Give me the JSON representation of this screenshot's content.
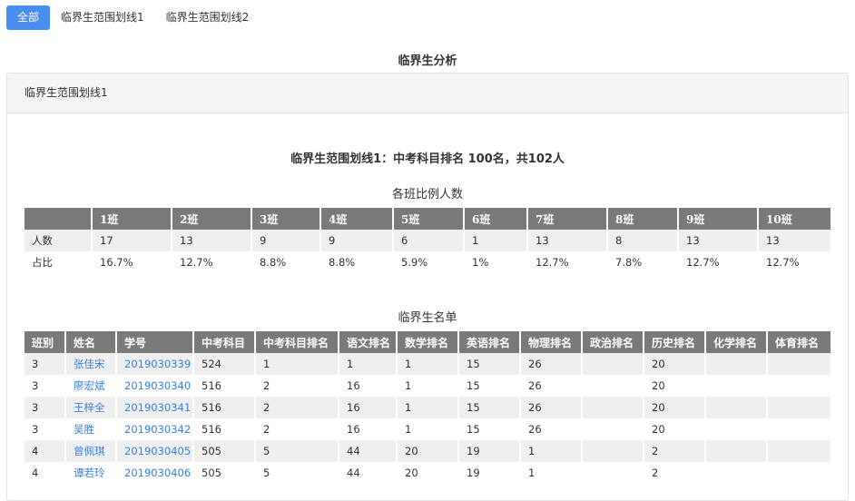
{
  "tabs": [
    "全部",
    "临界生范围划线1",
    "临界生范围划线2"
  ],
  "page_title": "临界生分析",
  "panel": {
    "header": "临界生范围划线1",
    "summary": "临界生范围划线1：中考科目排名 100名，共102人",
    "ratio_caption": "各班比例人数",
    "ratio_table": {
      "headers": [
        "",
        "1班",
        "2班",
        "3班",
        "4班",
        "5班",
        "6班",
        "7班",
        "8班",
        "9班",
        "10班"
      ],
      "rows": [
        [
          "人数",
          "17",
          "13",
          "9",
          "9",
          "6",
          "1",
          "13",
          "8",
          "13",
          "13"
        ],
        [
          "占比",
          "16.7%",
          "12.7%",
          "8.8%",
          "8.8%",
          "5.9%",
          "1%",
          "12.7%",
          "7.8%",
          "12.7%",
          "12.7%"
        ]
      ]
    },
    "list_caption": "临界生名单",
    "list_table": {
      "headers": [
        "班别",
        "姓名",
        "学号",
        "中考科目",
        "中考科目排名",
        "语文排名",
        "数学排名",
        "英语排名",
        "物理排名",
        "政治排名",
        "历史排名",
        "化学排名",
        "体育排名"
      ],
      "rows": [
        [
          "3",
          "张佳宋",
          "2019030339",
          "524",
          "1",
          "1",
          "1",
          "15",
          "26",
          "",
          "20",
          "",
          ""
        ],
        [
          "3",
          "廖宏斌",
          "2019030340",
          "516",
          "2",
          "16",
          "1",
          "15",
          "26",
          "",
          "20",
          "",
          ""
        ],
        [
          "3",
          "王梓全",
          "2019030341",
          "516",
          "2",
          "16",
          "1",
          "15",
          "26",
          "",
          "20",
          "",
          ""
        ],
        [
          "3",
          "吴胜",
          "2019030342",
          "516",
          "2",
          "16",
          "1",
          "15",
          "26",
          "",
          "20",
          "",
          ""
        ],
        [
          "4",
          "曾佩琪",
          "2019030405",
          "505",
          "5",
          "44",
          "20",
          "19",
          "1",
          "",
          "2",
          "",
          ""
        ],
        [
          "4",
          "谭若玲",
          "2019030406",
          "505",
          "5",
          "44",
          "20",
          "19",
          "1",
          "",
          "2",
          "",
          ""
        ]
      ]
    }
  }
}
